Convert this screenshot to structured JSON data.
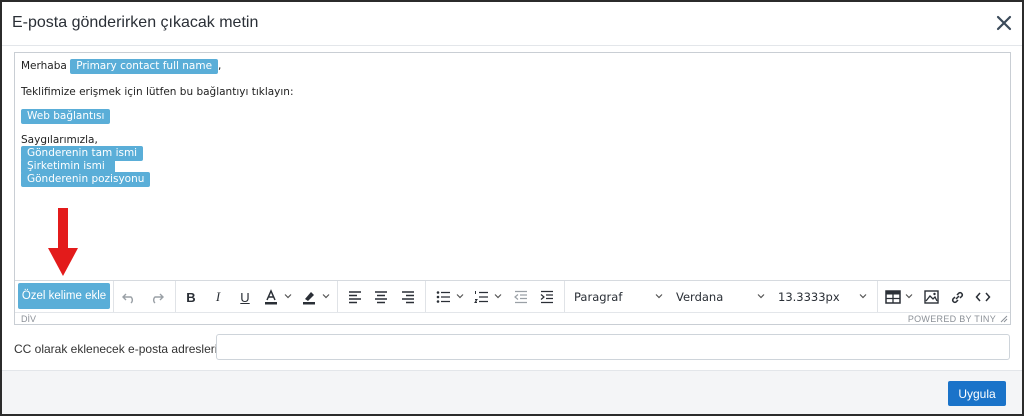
{
  "dialog": {
    "title": "E-posta gönderirken çıkacak metin"
  },
  "editor": {
    "greeting": "Merhaba",
    "greeting_tag": "Primary contact full name",
    "greeting_suffix": ",",
    "instruction": "Teklifimize erişmek için lütfen bu bağlantıyı tıklayın:",
    "link_tag": "Web bağlantısı",
    "closing": "Saygılarımızla,",
    "sender_tags": [
      "Gönderenin tam ismi",
      "Şirketimin ismi",
      "Gönderenin pozisyonu"
    ]
  },
  "toolbar": {
    "custom_word_button": "Özel kelime ekle",
    "block_format": "Paragraf",
    "font_family": "Verdana",
    "font_size": "13.3333px",
    "icons": [
      "undo-icon",
      "redo-icon",
      "bold-icon",
      "italic-icon",
      "underline-icon",
      "text-color-icon",
      "highlight-icon",
      "align-left-icon",
      "align-center-icon",
      "align-right-icon",
      "bullet-list-icon",
      "numbered-list-icon",
      "outdent-icon",
      "indent-icon",
      "table-icon",
      "image-icon",
      "link-icon",
      "code-icon"
    ]
  },
  "statusbar": {
    "path": "DİV",
    "branding": "POWERED BY TINY"
  },
  "cc": {
    "label": "CC olarak eklenecek e-posta adresleri:",
    "value": ""
  },
  "footer": {
    "apply_label": "Uygula"
  },
  "colors": {
    "tag_bg": "#5aaed8",
    "primary": "#1a73c9",
    "annotation_arrow": "#e31b1b"
  }
}
